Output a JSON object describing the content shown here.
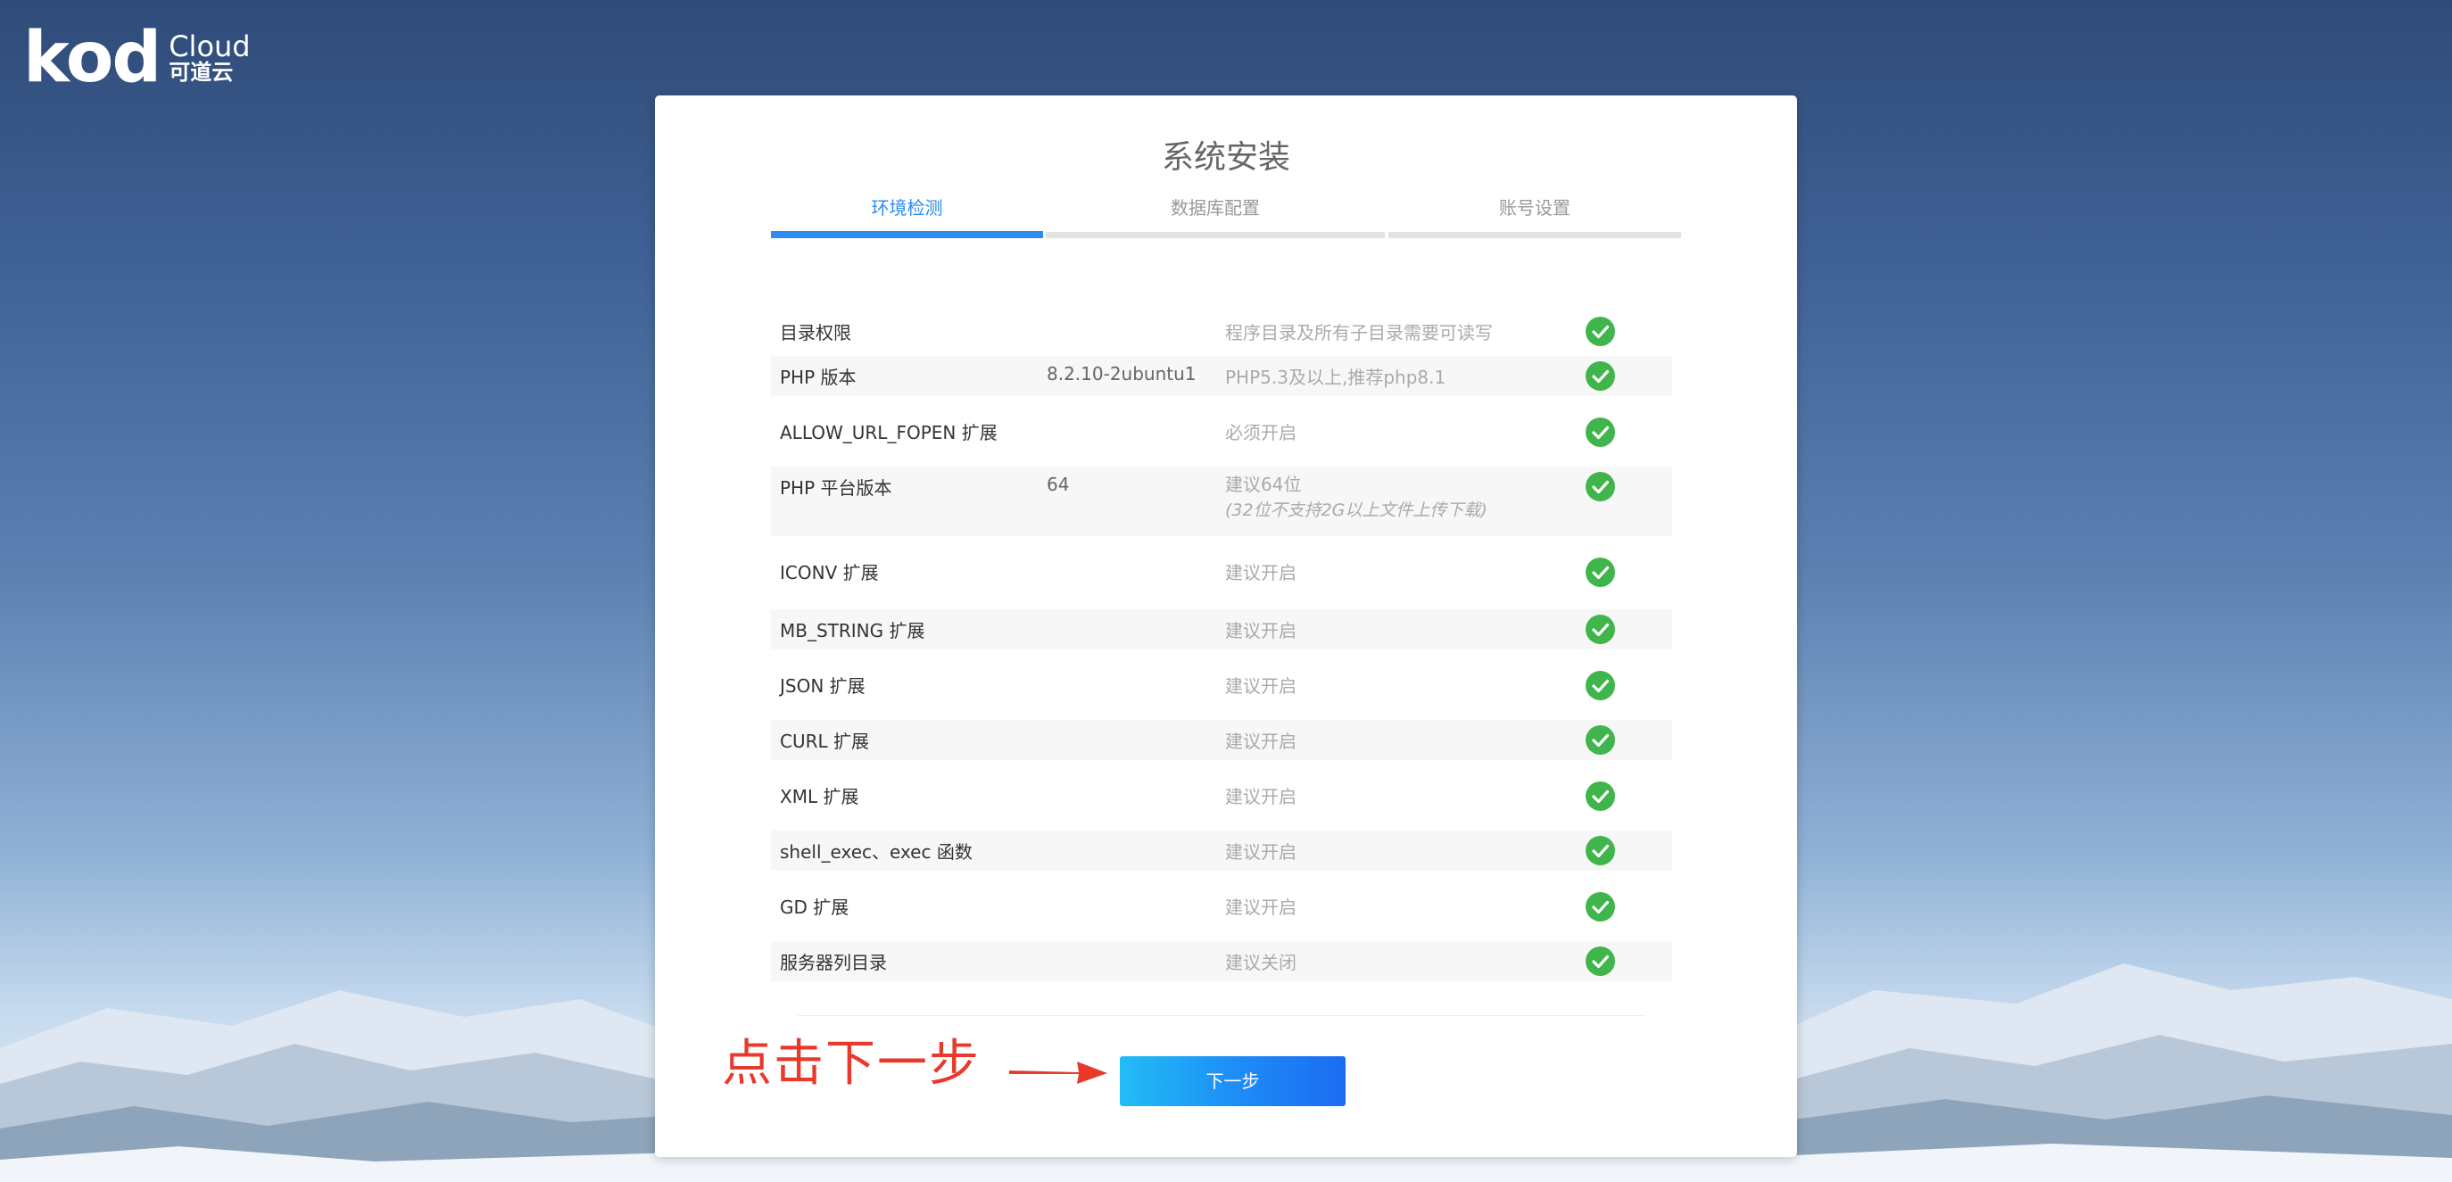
{
  "brand": {
    "logo_main": "kod",
    "logo_cloud": "Cloud",
    "logo_cn": "可道云"
  },
  "install": {
    "title": "系统安装",
    "steps": [
      {
        "label": "环境检测",
        "active": true
      },
      {
        "label": "数据库配置",
        "active": false
      },
      {
        "label": "账号设置",
        "active": false
      }
    ],
    "checks": [
      {
        "name": "目录权限",
        "value": "",
        "desc": "程序目录及所有子目录需要可读写",
        "note": "",
        "status": "check-circle-icon"
      },
      {
        "name": "PHP 版本",
        "value": "8.2.10-2ubuntu1",
        "desc": "PHP5.3及以上,推荐php8.1",
        "note": "",
        "status": "check-circle-icon"
      },
      {
        "name": "ALLOW_URL_FOPEN 扩展",
        "value": "",
        "desc": "必须开启",
        "note": "",
        "status": "check-circle-icon"
      },
      {
        "name": "PHP 平台版本",
        "value": "64",
        "desc": "建议64位",
        "note": "(32位不支持2G以上文件上传下载)",
        "status": "check-circle-icon"
      },
      {
        "name": "ICONV 扩展",
        "value": "",
        "desc": "建议开启",
        "note": "",
        "status": "check-circle-icon"
      },
      {
        "name": "MB_STRING 扩展",
        "value": "",
        "desc": "建议开启",
        "note": "",
        "status": "check-circle-icon"
      },
      {
        "name": "JSON 扩展",
        "value": "",
        "desc": "建议开启",
        "note": "",
        "status": "check-circle-icon"
      },
      {
        "name": "CURL 扩展",
        "value": "",
        "desc": "建议开启",
        "note": "",
        "status": "check-circle-icon"
      },
      {
        "name": "XML 扩展",
        "value": "",
        "desc": "建议开启",
        "note": "",
        "status": "check-circle-icon"
      },
      {
        "name": "shell_exec、exec 函数",
        "value": "",
        "desc": "建议开启",
        "note": "",
        "status": "check-circle-icon"
      },
      {
        "name": "GD 扩展",
        "value": "",
        "desc": "建议开启",
        "note": "",
        "status": "check-circle-icon"
      },
      {
        "name": "服务器列目录",
        "value": "",
        "desc": "建议关闭",
        "note": "",
        "status": "check-circle-icon"
      }
    ],
    "next_label": "下一步"
  },
  "annotation": {
    "text": "点击下一步",
    "color": "#e8392b"
  },
  "colors": {
    "accent": "#2d8cf0",
    "ok": "#3fb54c"
  }
}
